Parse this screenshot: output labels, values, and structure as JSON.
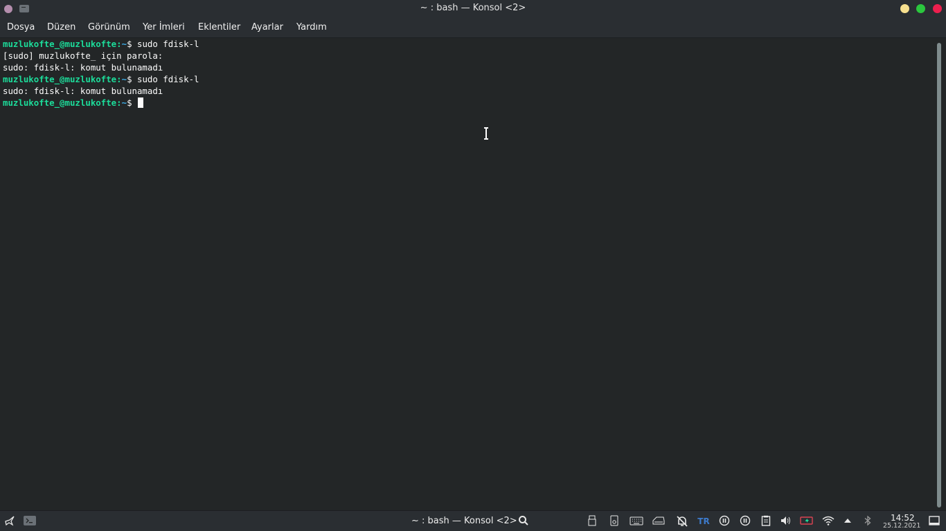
{
  "window": {
    "title": "~ : bash — Konsol <2>"
  },
  "menu": {
    "items": [
      "Dosya",
      "Düzen",
      "Görünüm",
      "Yer İmleri",
      "Eklentiler",
      "Ayarlar",
      "Yardım"
    ]
  },
  "terminal": {
    "lines": [
      {
        "user": "muzlukofte_@muzlukofte",
        "sep": ":",
        "path": "~",
        "rest": "$ sudo fdisk-l"
      },
      {
        "text": "[sudo] muzlukofte_ için parola:"
      },
      {
        "text": "sudo: fdisk-l: komut bulunamadı"
      },
      {
        "user": "muzlukofte_@muzlukofte",
        "sep": ":",
        "path": "~",
        "rest": "$ sudo fdisk-l"
      },
      {
        "text": "sudo: fdisk-l: komut bulunamadı"
      },
      {
        "user": "muzlukofte_@muzlukofte",
        "sep": ":",
        "path": "~",
        "rest": "$"
      }
    ]
  },
  "taskbar": {
    "task_title": "~ : bash — Konsol <2>",
    "keyboard_layout": "TR",
    "clock_time": "14:52",
    "clock_date": "25.12.2021"
  },
  "colors": {
    "prompt_user": "#1cdc9a",
    "prompt_path": "#3daee9",
    "background": "#232627"
  }
}
